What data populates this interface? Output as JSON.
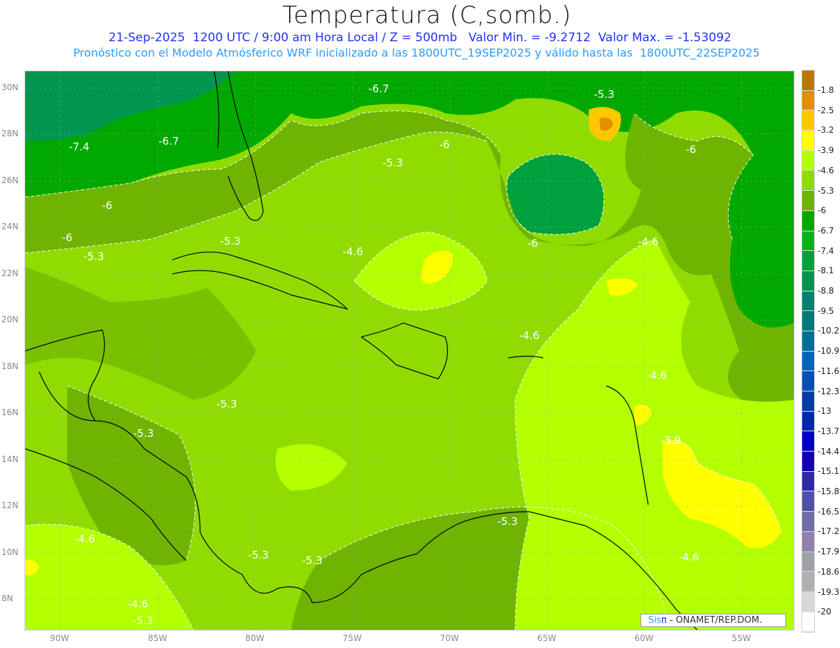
{
  "header": {
    "title": "Temperatura (C,somb.)",
    "subtitle1": "21-Sep-2025  1200 UTC / 9:00 am Hora Local / Z = 500mb   Valor Min. = -9.2712  Valor Max. = -1.53092",
    "subtitle2": "Pronóstico con el Modelo Atmósferico WRF inicializado a las 1800UTC_19SEP2025 y válido hasta las  1800UTC_22SEP2025"
  },
  "axes": {
    "lat_labels": [
      "30N",
      "28N",
      "26N",
      "24N",
      "22N",
      "20N",
      "18N",
      "16N",
      "14N",
      "12N",
      "10N",
      "8N"
    ],
    "lon_labels": [
      "90W",
      "85W",
      "80W",
      "75W",
      "70W",
      "65W",
      "60W",
      "55W"
    ]
  },
  "colorbar": {
    "labels": [
      "-1.8",
      "-2.5",
      "-3.2",
      "-3.9",
      "-4.6",
      "-5.3",
      "-6",
      "-6.7",
      "-7.4",
      "-8.1",
      "-8.8",
      "-9.5",
      "-10.2",
      "-10.9",
      "-11.6",
      "-12.3",
      "-13",
      "-13.7",
      "-14.4",
      "-15.1",
      "-15.8",
      "-16.5",
      "-17.2",
      "-17.9",
      "-18.6",
      "-19.3",
      "-20"
    ],
    "colors": [
      "#b87800",
      "#e09000",
      "#ffc800",
      "#ffff00",
      "#b4ff00",
      "#90dc00",
      "#6eb400",
      "#00a800",
      "#00b41e",
      "#00a03c",
      "#009650",
      "#00826e",
      "#007878",
      "#006e96",
      "#0064be",
      "#0050b4",
      "#003ca8",
      "#0028b0",
      "#0000c8",
      "#1400b4",
      "#3028a8",
      "#5050a8",
      "#6e6eaa",
      "#9080b0",
      "#a0a0a8",
      "#b0b0b0",
      "#d8d8d8",
      "#ffffff"
    ]
  },
  "contour_labels": [
    "-6.7",
    "-5.3",
    "-7.4",
    "-6.7",
    "-6",
    "-6",
    "-5.3",
    "-6",
    "-6",
    "-5.3",
    "-5.3",
    "-4.6",
    "-6",
    "-4.6",
    "-4.6",
    "-4.6",
    "-5.3",
    "-5.3",
    "-3.9",
    "-5.3",
    "-4.6",
    "-5.3",
    "-5.3",
    "-4.6",
    "-4.6",
    "-5.3"
  ],
  "credit": {
    "logo_sis": "Sis",
    "logo_pi": "π",
    "text": "- ONAMET/REP.DOM."
  }
}
